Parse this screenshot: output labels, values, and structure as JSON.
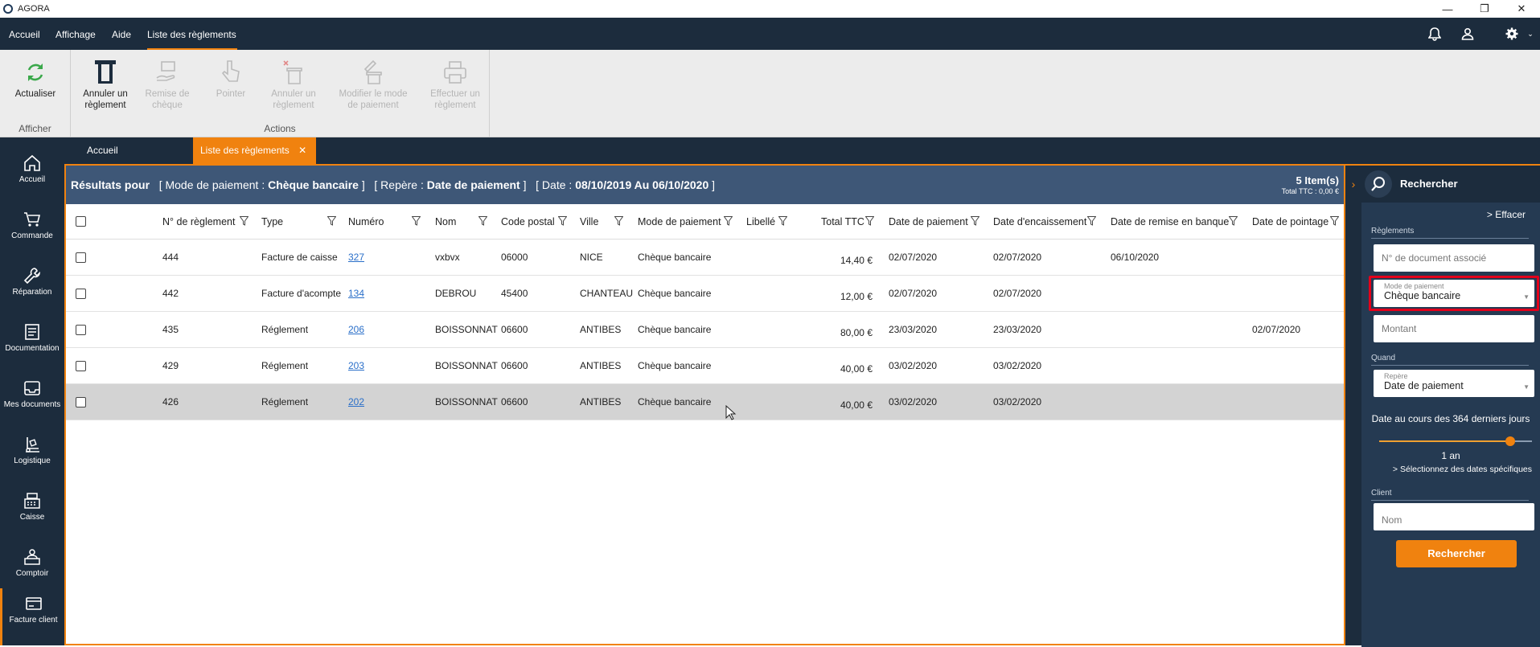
{
  "app": {
    "title": "AGORA"
  },
  "window": {
    "minimize": "—",
    "restore": "❐",
    "close": "✕"
  },
  "menu": {
    "items": [
      "Accueil",
      "Affichage",
      "Aide",
      "Liste des règlements"
    ]
  },
  "ribbon": {
    "groups": [
      {
        "label": "Afficher",
        "buttons": [
          {
            "label": "Actualiser",
            "icon": "refresh-icon",
            "enabled": true
          }
        ]
      },
      {
        "label": "Actions",
        "buttons": [
          {
            "label": "Annuler un règlement",
            "icon": "cancel-payment-icon",
            "enabled": true
          },
          {
            "label": "Remise de chèque",
            "icon": "cheque-deposit-icon",
            "enabled": false
          },
          {
            "label": "Pointer",
            "icon": "pointer-icon",
            "enabled": false
          },
          {
            "label": "Annuler un règlement",
            "icon": "trash-cancel-icon",
            "enabled": false
          },
          {
            "label": "Modifier le mode de paiement",
            "icon": "edit-payment-icon",
            "enabled": false
          },
          {
            "label": "Effectuer un règlement",
            "icon": "printer-icon",
            "enabled": false
          }
        ]
      }
    ]
  },
  "nav": {
    "items": [
      {
        "label": "Accueil",
        "icon": "home-icon"
      },
      {
        "label": "Commande",
        "icon": "cart-icon"
      },
      {
        "label": "Réparation",
        "icon": "wrench-icon"
      },
      {
        "label": "Documentation",
        "icon": "document-icon"
      },
      {
        "label": "Mes documents",
        "icon": "inbox-icon"
      },
      {
        "label": "Logistique",
        "icon": "logistics-icon"
      },
      {
        "label": "Caisse",
        "icon": "cash-register-icon"
      },
      {
        "label": "Comptoir",
        "icon": "counter-icon"
      },
      {
        "label": "Facture client",
        "icon": "invoice-icon"
      }
    ]
  },
  "tabs": [
    {
      "label": "Accueil"
    },
    {
      "label": "Liste des règlements",
      "close": "✕"
    }
  ],
  "results": {
    "prefix": "Résultats pour",
    "crit1_label": "[ Mode de paiement :",
    "crit1_value": "Chèque bancaire",
    "crit1_end": "]",
    "crit2_label": "[ Repère :",
    "crit2_value": "Date de paiement",
    "crit2_end": "]",
    "crit3_label": "[ Date :",
    "crit3_value": "08/10/2019 Au 06/10/2020",
    "crit3_end": "]",
    "count": "5 Item(s)",
    "total": "Total TTC : 0,00 €"
  },
  "table": {
    "columns": [
      "N° de règlement",
      "Type",
      "Numéro",
      "Nom",
      "Code postal",
      "Ville",
      "Mode de paiement",
      "Libellé",
      "Total TTC",
      "Date de paiement",
      "Date d'encaissement",
      "Date de remise en banque",
      "Date de pointage"
    ],
    "rows": [
      [
        "444",
        "Facture de caisse",
        "327",
        "vxbvx",
        "06000",
        "NICE",
        "Chèque bancaire",
        "",
        "14,40 €",
        "02/07/2020",
        "02/07/2020",
        "06/10/2020",
        ""
      ],
      [
        "442",
        "Facture d'acompte",
        "134",
        "DEBROU",
        "45400",
        "CHANTEAU",
        "Chèque bancaire",
        "",
        "12,00 €",
        "02/07/2020",
        "02/07/2020",
        "",
        ""
      ],
      [
        "435",
        "Réglement",
        "206",
        "BOISSONNAT",
        "06600",
        "ANTIBES",
        "Chèque bancaire",
        "",
        "80,00 €",
        "23/03/2020",
        "23/03/2020",
        "",
        "02/07/2020"
      ],
      [
        "429",
        "Réglement",
        "203",
        "BOISSONNAT",
        "06600",
        "ANTIBES",
        "Chèque bancaire",
        "",
        "40,00 €",
        "03/02/2020",
        "03/02/2020",
        "",
        ""
      ],
      [
        "426",
        "Réglement",
        "202",
        "BOISSONNAT",
        "06600",
        "ANTIBES",
        "Chèque bancaire",
        "",
        "40,00 €",
        "03/02/2020",
        "03/02/2020",
        "",
        ""
      ]
    ],
    "selected_row": 4
  },
  "search": {
    "title": "Rechercher",
    "toggle": "›",
    "clear": "> Effacer",
    "section_payments": "Règlements",
    "doc_placeholder": "N° de document associé",
    "mode_label": "Mode de paiement",
    "mode_value": "Chèque bancaire",
    "amount_placeholder": "Montant",
    "section_when": "Quand",
    "repere_label": "Repère",
    "repere_value": "Date de paiement",
    "range_text": "Date au cours des 364 derniers jours",
    "slider_value_label": "1 an",
    "slider_fraction": 0.7,
    "specific_dates": "> Sélectionnez des dates spécifiques",
    "section_client": "Client",
    "name_placeholder": "Nom",
    "button": "Rechercher"
  },
  "colors": {
    "accent": "#f0820f",
    "navy": "#1c2c3d",
    "header": "#3e5777",
    "highlight": "#e3001b",
    "link": "#2a6fc9"
  }
}
